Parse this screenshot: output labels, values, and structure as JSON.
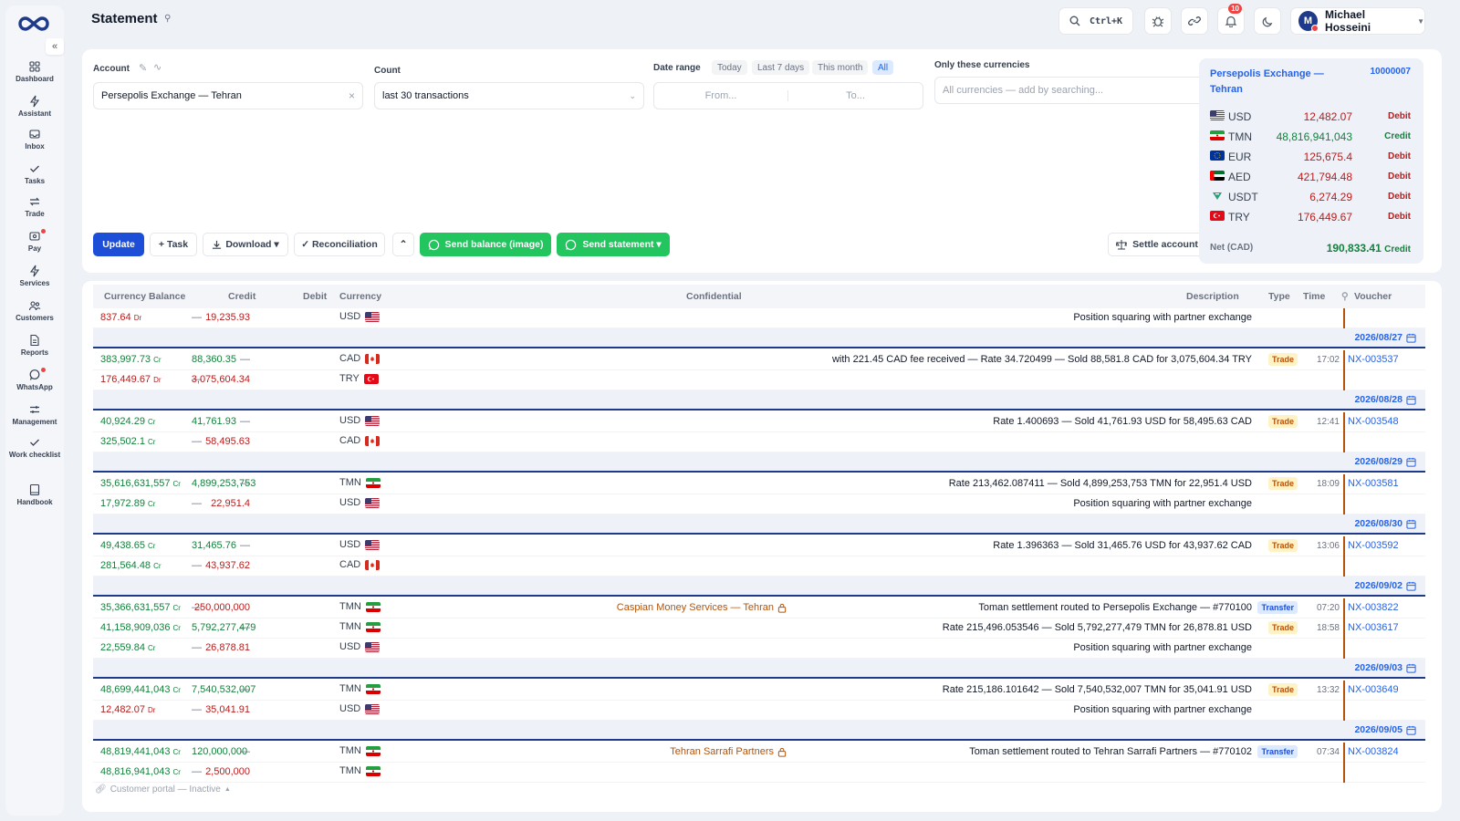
{
  "header": {
    "title": "Statement",
    "search_shortcut": "Ctrl+K",
    "notif_count": "10",
    "user_initial": "M",
    "user_name": "Michael Hosseini"
  },
  "sidebar": {
    "items": [
      {
        "label": "Dashboard",
        "icon": "dashboard-icon"
      },
      {
        "label": "Assistant",
        "icon": "assistant-icon"
      },
      {
        "label": "Inbox",
        "icon": "inbox-icon"
      },
      {
        "label": "Tasks",
        "icon": "tasks-icon"
      },
      {
        "label": "Trade",
        "icon": "trade-icon"
      },
      {
        "label": "Pay",
        "icon": "pay-icon"
      },
      {
        "label": "Services",
        "icon": "services-icon"
      },
      {
        "label": "Customers",
        "icon": "customers-icon"
      },
      {
        "label": "Reports",
        "icon": "reports-icon"
      },
      {
        "label": "WhatsApp",
        "icon": "whatsapp-icon"
      },
      {
        "label": "Management",
        "icon": "management-icon"
      },
      {
        "label": "Work checklist",
        "icon": "checklist-icon"
      },
      {
        "label": "Handbook",
        "icon": "handbook-icon"
      }
    ]
  },
  "filters": {
    "account_label": "Account",
    "account_value": "Persepolis Exchange — Tehran",
    "count_label": "Count",
    "count_value": "last 30 transactions",
    "date_label": "Date range",
    "date_chips": [
      "Today",
      "Last 7 days",
      "This month",
      "All"
    ],
    "from_placeholder": "From...",
    "to_placeholder": "To...",
    "currencies_label": "Only these currencies",
    "currencies_placeholder": "All currencies — add by searching..."
  },
  "actions": {
    "update": "Update",
    "task": "+ Task",
    "download": "Download ▾",
    "reconciliation": "✓ Reconciliation",
    "send_balance": "Send balance (image)",
    "send_statement": "Send statement ▾",
    "settle": "Settle account"
  },
  "balance_card": {
    "title": "Persepolis Exchange — Tehran",
    "account_id": "10000007",
    "rows": [
      {
        "cur": "USD",
        "amount": "12,482.07",
        "type": "Debit"
      },
      {
        "cur": "TMN",
        "amount": "48,816,941,043",
        "type": "Credit"
      },
      {
        "cur": "EUR",
        "amount": "125,675.4",
        "type": "Debit"
      },
      {
        "cur": "AED",
        "amount": "421,794.48",
        "type": "Debit"
      },
      {
        "cur": "USDT",
        "amount": "6,274.29",
        "type": "Debit"
      },
      {
        "cur": "TRY",
        "amount": "176,449.67",
        "type": "Debit"
      }
    ],
    "net_label": "Net (CAD)",
    "net_value": "190,833.41",
    "net_type": "Credit"
  },
  "table": {
    "columns": {
      "balance": "Currency Balance",
      "credit": "Credit",
      "debit": "Debit",
      "currency": "Currency",
      "confidential": "Confidential",
      "description": "Description",
      "type": "Type",
      "time": "Time",
      "voucher": "Voucher"
    },
    "rows": [
      {
        "bal": "837.64",
        "sfx": "Dr",
        "cr": "—",
        "dr": "19,235.93",
        "ccy": "USD",
        "conf": "",
        "desc": "Position squaring with partner exchange",
        "type": "",
        "time": "",
        "vch": ""
      },
      {
        "date": "2026/08/27"
      },
      {
        "bal": "383,997.73",
        "sfx": "Cr",
        "cr": "88,360.35",
        "dr": "—",
        "ccy": "CAD",
        "conf": "",
        "desc": "with 221.45 CAD fee received — Rate 34.720499 — Sold 88,581.8 CAD for 3,075,604.34 TRY",
        "type": "Trade",
        "time": "17:02",
        "vch": "NX-003537"
      },
      {
        "bal": "176,449.67",
        "sfx": "Dr",
        "cr": "—",
        "dr": "3,075,604.34",
        "ccy": "TRY",
        "conf": "",
        "desc": "",
        "type": "",
        "time": "",
        "vch": ""
      },
      {
        "date": "2026/08/28"
      },
      {
        "bal": "40,924.29",
        "sfx": "Cr",
        "cr": "41,761.93",
        "dr": "—",
        "ccy": "USD",
        "conf": "",
        "desc": "Rate 1.400693 — Sold 41,761.93 USD for 58,495.63 CAD",
        "type": "Trade",
        "time": "12:41",
        "vch": "NX-003548"
      },
      {
        "bal": "325,502.1",
        "sfx": "Cr",
        "cr": "—",
        "dr": "58,495.63",
        "ccy": "CAD",
        "conf": "",
        "desc": "",
        "type": "",
        "time": "",
        "vch": ""
      },
      {
        "date": "2026/08/29"
      },
      {
        "bal": "35,616,631,557",
        "sfx": "Cr",
        "cr": "4,899,253,753",
        "dr": "—",
        "ccy": "TMN",
        "conf": "",
        "desc": "Rate 213,462.087411 — Sold 4,899,253,753 TMN for 22,951.4 USD",
        "type": "Trade",
        "time": "18:09",
        "vch": "NX-003581"
      },
      {
        "bal": "17,972.89",
        "sfx": "Cr",
        "cr": "—",
        "dr": "22,951.4",
        "ccy": "USD",
        "conf": "",
        "desc": "Position squaring with partner exchange",
        "type": "",
        "time": "",
        "vch": ""
      },
      {
        "date": "2026/08/30"
      },
      {
        "bal": "49,438.65",
        "sfx": "Cr",
        "cr": "31,465.76",
        "dr": "—",
        "ccy": "USD",
        "conf": "",
        "desc": "Rate 1.396363 — Sold 31,465.76 USD for 43,937.62 CAD",
        "type": "Trade",
        "time": "13:06",
        "vch": "NX-003592"
      },
      {
        "bal": "281,564.48",
        "sfx": "Cr",
        "cr": "—",
        "dr": "43,937.62",
        "ccy": "CAD",
        "conf": "",
        "desc": "",
        "type": "",
        "time": "",
        "vch": ""
      },
      {
        "date": "2026/09/02"
      },
      {
        "bal": "35,366,631,557",
        "sfx": "Cr",
        "cr": "—",
        "dr": "250,000,000",
        "ccy": "TMN",
        "conf": "Caspian Money Services — Tehran",
        "desc": "Toman settlement routed to Persepolis Exchange — #770100",
        "type": "Transfer",
        "time": "07:20",
        "vch": "NX-003822"
      },
      {
        "bal": "41,158,909,036",
        "sfx": "Cr",
        "cr": "5,792,277,479",
        "dr": "—",
        "ccy": "TMN",
        "conf": "",
        "desc": "Rate 215,496.053546 — Sold 5,792,277,479 TMN for 26,878.81 USD",
        "type": "Trade",
        "time": "18:58",
        "vch": "NX-003617"
      },
      {
        "bal": "22,559.84",
        "sfx": "Cr",
        "cr": "—",
        "dr": "26,878.81",
        "ccy": "USD",
        "conf": "",
        "desc": "Position squaring with partner exchange",
        "type": "",
        "time": "",
        "vch": ""
      },
      {
        "date": "2026/09/03"
      },
      {
        "bal": "48,699,441,043",
        "sfx": "Cr",
        "cr": "7,540,532,007",
        "dr": "—",
        "ccy": "TMN",
        "conf": "",
        "desc": "Rate 215,186.101642 — Sold 7,540,532,007 TMN for 35,041.91 USD",
        "type": "Trade",
        "time": "13:32",
        "vch": "NX-003649"
      },
      {
        "bal": "12,482.07",
        "sfx": "Dr",
        "cr": "—",
        "dr": "35,041.91",
        "ccy": "USD",
        "conf": "",
        "desc": "Position squaring with partner exchange",
        "type": "",
        "time": "",
        "vch": ""
      },
      {
        "date": "2026/09/05"
      },
      {
        "bal": "48,819,441,043",
        "sfx": "Cr",
        "cr": "120,000,000",
        "dr": "—",
        "ccy": "TMN",
        "conf": "Tehran Sarrafi Partners",
        "desc": "Toman settlement routed to Tehran Sarrafi Partners — #770102",
        "type": "Transfer",
        "time": "07:34",
        "vch": "NX-003824"
      },
      {
        "bal": "48,816,941,043",
        "sfx": "Cr",
        "cr": "—",
        "dr": "2,500,000",
        "ccy": "TMN",
        "conf": "",
        "desc": "",
        "type": "",
        "time": "",
        "vch": ""
      }
    ]
  },
  "footer": {
    "portal": "Customer portal — Inactive"
  },
  "colors": {
    "accent": "#1d4ed8",
    "green": "#22c55e",
    "credit": "#15803d",
    "debit": "#b91c1c",
    "trade_badge": "#fef3c7",
    "transfer_badge": "#dbeafe"
  }
}
